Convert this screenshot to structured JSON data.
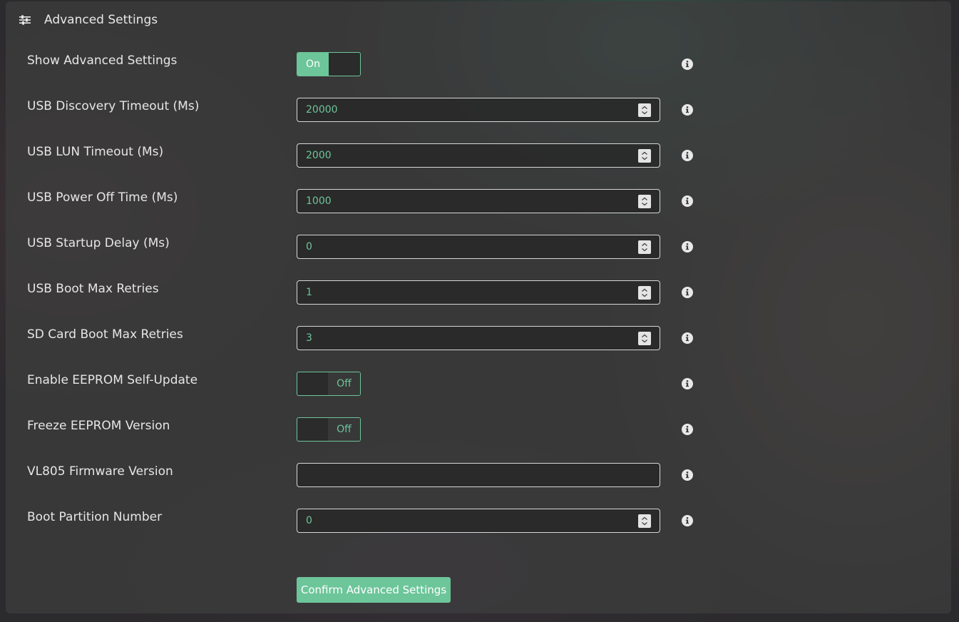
{
  "header": {
    "title": "Advanced Settings",
    "icon": "sliders-icon"
  },
  "rows": [
    {
      "id": "show-advanced-settings",
      "label": "Show Advanced Settings",
      "type": "toggle",
      "state": "on",
      "toggle_label": "On"
    },
    {
      "id": "usb-discovery-timeout",
      "label": "USB Discovery Timeout (Ms)",
      "type": "number",
      "value": "20000"
    },
    {
      "id": "usb-lun-timeout",
      "label": "USB LUN Timeout (Ms)",
      "type": "number",
      "value": "2000"
    },
    {
      "id": "usb-power-off-time",
      "label": "USB Power Off Time (Ms)",
      "type": "number",
      "value": "1000"
    },
    {
      "id": "usb-startup-delay",
      "label": "USB Startup Delay (Ms)",
      "type": "number",
      "value": "0"
    },
    {
      "id": "usb-boot-max-retries",
      "label": "USB Boot Max Retries",
      "type": "number",
      "value": "1"
    },
    {
      "id": "sd-card-boot-max-retries",
      "label": "SD Card Boot Max Retries",
      "type": "number",
      "value": "3"
    },
    {
      "id": "enable-eeprom-self-update",
      "label": "Enable EEPROM Self-Update",
      "type": "toggle",
      "state": "off",
      "toggle_label": "Off"
    },
    {
      "id": "freeze-eeprom-version",
      "label": "Freeze EEPROM Version",
      "type": "toggle",
      "state": "off",
      "toggle_label": "Off"
    },
    {
      "id": "vl805-firmware-version",
      "label": "VL805 Firmware Version",
      "type": "text",
      "value": ""
    },
    {
      "id": "boot-partition-number",
      "label": "Boot Partition Number",
      "type": "number",
      "value": "0"
    }
  ],
  "confirm_button": {
    "label": "Confirm Advanced Settings"
  },
  "colors": {
    "accent": "#6dc59a",
    "text": "#e6e6e6",
    "input_border": "#d7d7d7"
  }
}
